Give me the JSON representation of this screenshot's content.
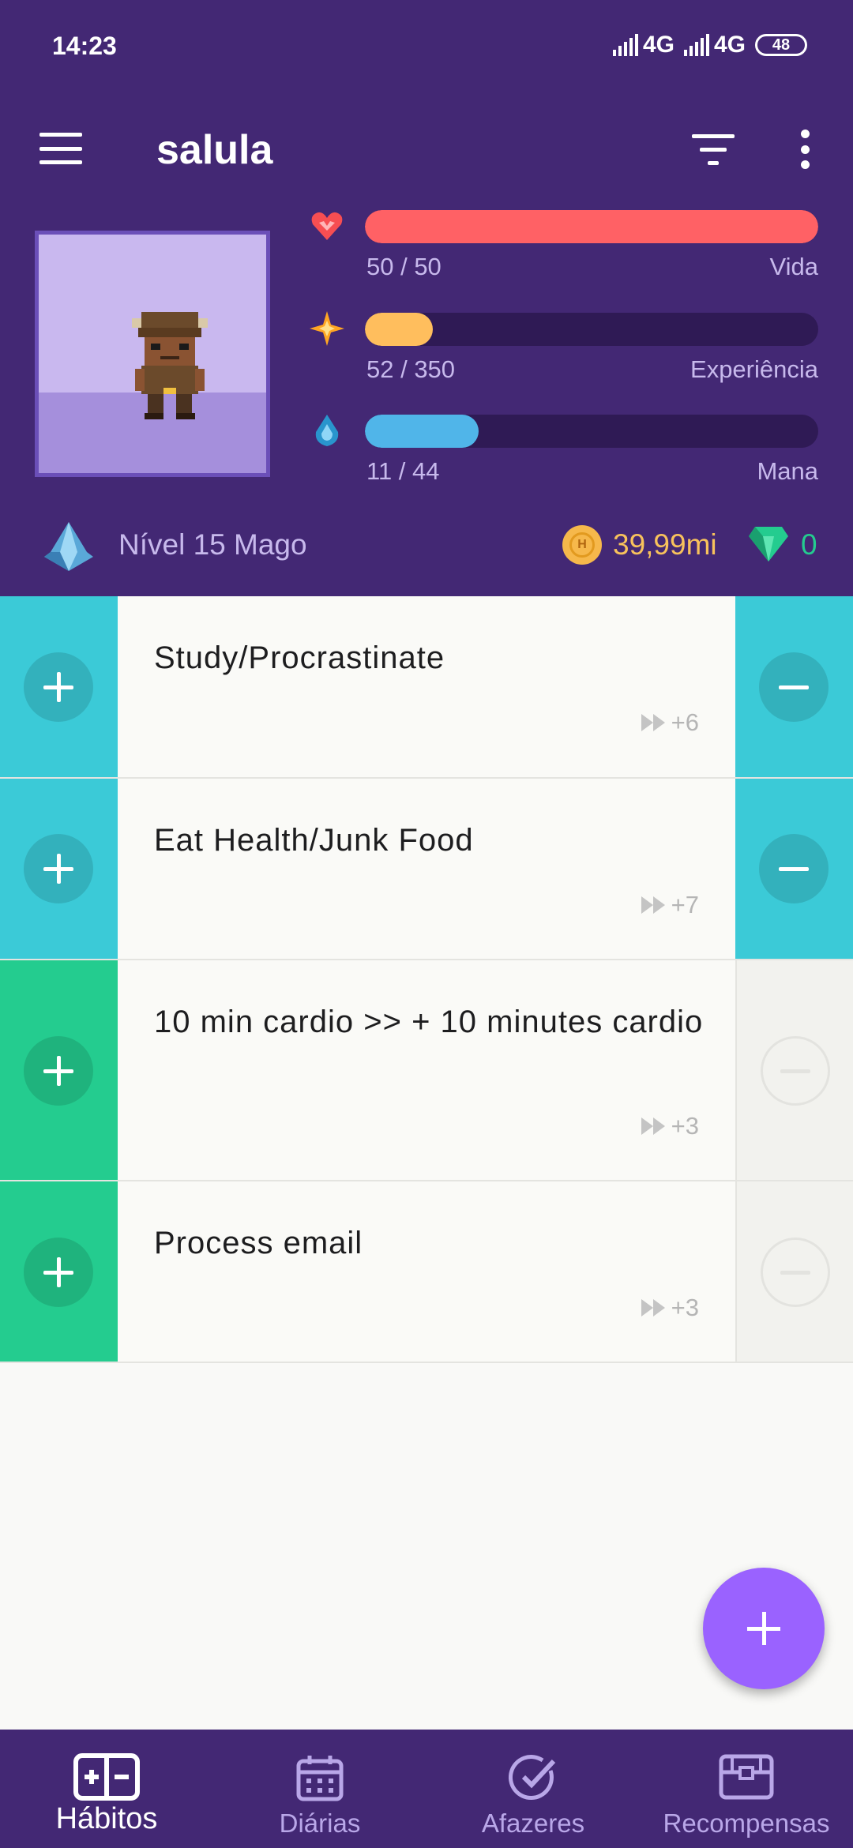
{
  "status_bar": {
    "time": "14:23",
    "network1": "4G",
    "network2": "4G",
    "battery": "48"
  },
  "toolbar": {
    "title": "salula"
  },
  "stats": {
    "health": {
      "value": "50 / 50",
      "label": "Vida",
      "fraction": 1.0,
      "color": "#ff6165"
    },
    "experience": {
      "value": "52 / 350",
      "label": "Experiência",
      "fraction": 0.149,
      "color": "#ffbe5d"
    },
    "mana": {
      "value": "11 / 44",
      "label": "Mana",
      "fraction": 0.25,
      "color": "#50b5e9"
    }
  },
  "level": {
    "text": "Nível 15 Mago",
    "gold": "39,99mi",
    "gems": "0"
  },
  "habits": [
    {
      "title": "Study/Procrastinate",
      "streak": "+6",
      "color": "#3bcad7",
      "negative_enabled": true
    },
    {
      "title": "Eat Health/Junk Food",
      "streak": "+7",
      "color": "#3bcad7",
      "negative_enabled": true
    },
    {
      "title": "10 min cardio >> + 10 minutes cardio",
      "streak": "+3",
      "color": "#24cc8f",
      "negative_enabled": false
    },
    {
      "title": "Process email",
      "streak": "+3",
      "color": "#24cc8f",
      "negative_enabled": false
    }
  ],
  "bottom_nav": [
    {
      "label": "Hábitos",
      "icon": "habits-icon",
      "active": true
    },
    {
      "label": "Diárias",
      "icon": "calendar-icon",
      "active": false
    },
    {
      "label": "Afazeres",
      "icon": "checkmark-icon",
      "active": false
    },
    {
      "label": "Recompensas",
      "icon": "chest-icon",
      "active": false
    }
  ]
}
